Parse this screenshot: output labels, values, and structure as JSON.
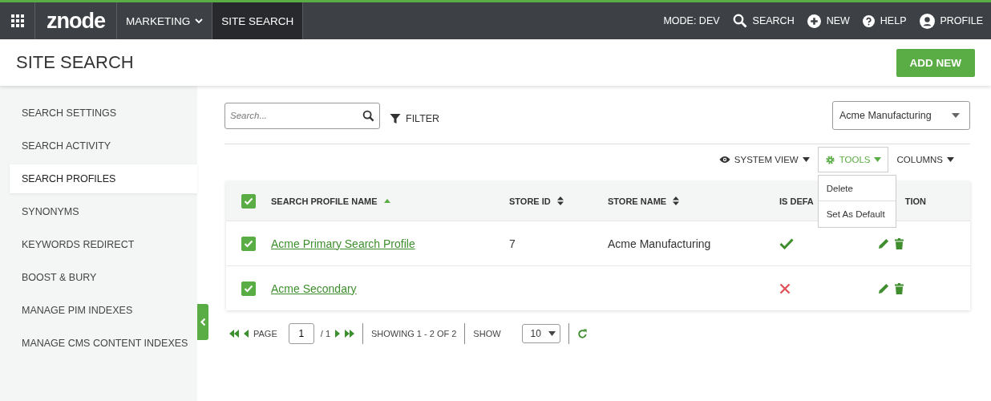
{
  "topbar": {
    "logo": "znode",
    "nav": [
      {
        "label": "MARKETING",
        "selected": false,
        "dropdown": true
      },
      {
        "label": "SITE SEARCH",
        "selected": true,
        "dropdown": false
      }
    ],
    "mode": "MODE: DEV",
    "actions": [
      {
        "kind": "search",
        "label": "SEARCH"
      },
      {
        "kind": "new",
        "label": "NEW"
      },
      {
        "kind": "help",
        "label": "HELP"
      },
      {
        "kind": "profile",
        "label": "PROFILE"
      }
    ]
  },
  "page": {
    "title": "SITE SEARCH",
    "add_button": "ADD NEW"
  },
  "sidebar": {
    "items": [
      {
        "label": "SEARCH SETTINGS",
        "selected": false
      },
      {
        "label": "SEARCH ACTIVITY",
        "selected": false
      },
      {
        "label": "SEARCH PROFILES",
        "selected": true
      },
      {
        "label": "SYNONYMS",
        "selected": false
      },
      {
        "label": "KEYWORDS REDIRECT",
        "selected": false
      },
      {
        "label": "BOOST & BURY",
        "selected": false
      },
      {
        "label": "MANAGE PIM INDEXES",
        "selected": false
      },
      {
        "label": "MANAGE CMS CONTENT INDEXES",
        "selected": false
      }
    ]
  },
  "toolbar": {
    "search": {
      "placeholder": "Search..."
    },
    "filter": "FILTER",
    "store_select": "Acme Manufacturing",
    "system_view": "SYSTEM VIEW",
    "tools": "TOOLS",
    "columns": "COLUMNS",
    "tools_menu": [
      "Delete",
      "Set As Default"
    ]
  },
  "table": {
    "select_all": true,
    "columns": [
      {
        "label": "SEARCH PROFILE NAME",
        "sortable": true,
        "sorted": true
      },
      {
        "label": "STORE ID",
        "sortable": true,
        "sorted": false
      },
      {
        "label": "STORE NAME",
        "sortable": true,
        "sorted": false
      },
      {
        "label": "IS DEFA",
        "sortable": false
      },
      {
        "label": "TION",
        "sortable": false
      }
    ],
    "rows": [
      {
        "checked": true,
        "name": "Acme Primary Search Profile",
        "store_id": "7",
        "store_name": "Acme Manufacturing",
        "is_default": true
      },
      {
        "checked": true,
        "name": "Acme Secondary",
        "is_default": false
      }
    ]
  },
  "pager": {
    "page_label": "PAGE",
    "page": "1",
    "of": "/ 1",
    "showing": "SHOWING 1 - 2 OF 2",
    "show_label": "SHOW",
    "page_size": "10"
  }
}
